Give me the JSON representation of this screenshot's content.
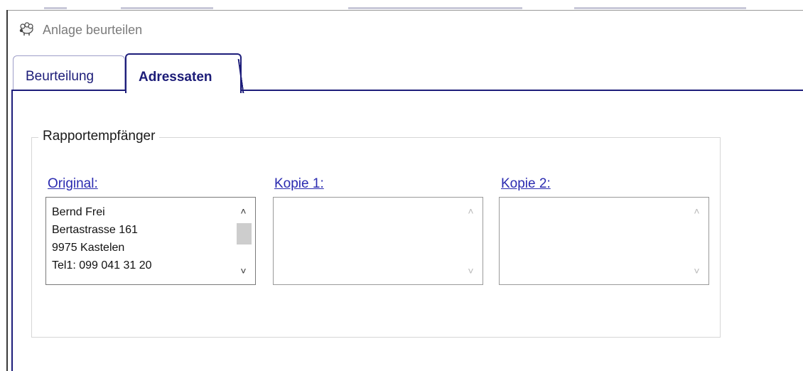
{
  "window": {
    "title": "Anlage beurteilen",
    "icon": "sheep-app-icon"
  },
  "tabs": [
    {
      "label": "Beurteilung",
      "active": false
    },
    {
      "label": "Adressaten",
      "active": true
    }
  ],
  "group": {
    "title": "Rapportempfänger"
  },
  "recipients": {
    "original": {
      "label": "Original:",
      "lines": [
        "Bernd Frei",
        "Bertastrasse 161",
        "9975 Kastelen",
        "Tel1: 099 041 31 20"
      ]
    },
    "kopie1": {
      "label": "Kopie 1:"
    },
    "kopie2": {
      "label": "Kopie 2:"
    }
  },
  "colors": {
    "accent": "#1d1d7a",
    "link": "#2a2ab0",
    "title_gray": "#7b7b7b"
  }
}
